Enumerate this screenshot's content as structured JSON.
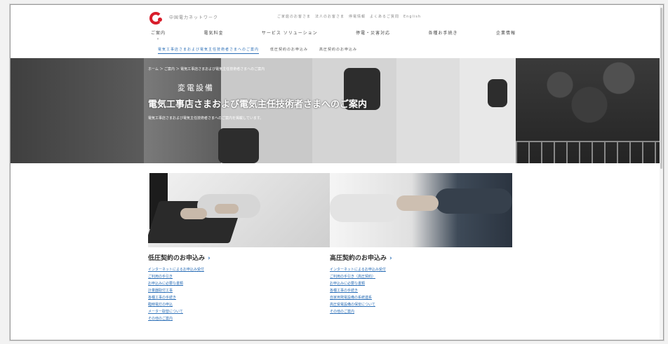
{
  "header": {
    "brand": "中国電力ネットワーク",
    "utility_links": "ご家庭のお客さま　法人のお客さま　停電情報　よくあるご質問　English"
  },
  "nav": {
    "items": [
      {
        "label": "ご案内"
      },
      {
        "label": "電気料金"
      },
      {
        "label": "サービス ソリューション"
      },
      {
        "label": "停電・災害対応"
      },
      {
        "label": "各種お手続き"
      },
      {
        "label": "企業情報"
      }
    ]
  },
  "subnav": {
    "active": "電気工事店さまおよび電気主任技術者さまへのご案内",
    "tabs": [
      "低圧契約のお申込み",
      "高圧契約のお申込み"
    ]
  },
  "hero": {
    "breadcrumb": "ホーム ＞ ご案内 ＞ 電気工事店さまおよび電気主任技術者さまへのご案内",
    "sign": "変電設備",
    "title": "電気工事店さまおよび電気主任技術者さまへのご案内",
    "subtitle": "電気工事店さまおよび電気主任技術者さまへのご案内を掲載しています。"
  },
  "cards": [
    {
      "title": "低圧契約のお申込み",
      "links": [
        "インターネットによるお申込み受付",
        "ご利用の手引き",
        "お申込みに必要な書類",
        "計量器取付工事",
        "各種工事の手続き",
        "臨時電灯の申込",
        "メーター取替について",
        "その他のご案内"
      ]
    },
    {
      "title": "高圧契約のお申込み",
      "links": [
        "インターネットによるお申込み受付",
        "ご利用の手引き（高圧契約）",
        "お申込みに必要な書類",
        "各種工事の手続き",
        "自家用発電設備の系統連系",
        "高圧受電設備の保安について",
        "その他のご案内"
      ]
    }
  ],
  "colors": {
    "accent": "#2c6fb7",
    "brand": "#d81d2b"
  }
}
